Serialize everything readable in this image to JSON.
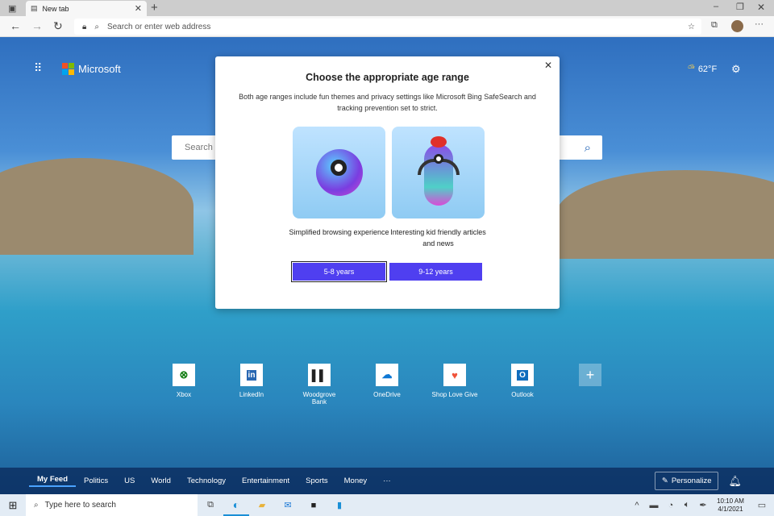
{
  "browser": {
    "tab_title": "New tab",
    "address_placeholder": "Search or enter web address"
  },
  "header": {
    "brand": "Microsoft",
    "weather": "62°F"
  },
  "search": {
    "placeholder": "Search the web"
  },
  "modal": {
    "title": "Choose the appropriate age range",
    "description": "Both age ranges include fun themes and privacy settings like Microsoft Bing SafeSearch and tracking prevention set to strict.",
    "options": [
      {
        "caption": "Simplified browsing experience",
        "button": "5-8 years"
      },
      {
        "caption": "Interesting kid friendly articles and news",
        "button": "9-12 years"
      }
    ]
  },
  "quick_links": [
    "Xbox",
    "LinkedIn",
    "Woodgrove Bank",
    "OneDrive",
    "Shop Love Give",
    "Outlook"
  ],
  "feed": {
    "tabs": [
      "My Feed",
      "Politics",
      "US",
      "World",
      "Technology",
      "Entertainment",
      "Sports",
      "Money"
    ],
    "more": "···",
    "personalize": "Personalize"
  },
  "taskbar": {
    "search_placeholder": "Type here to search",
    "time": "10:10 AM",
    "date": "4/1/2021"
  },
  "colors": {
    "accent": "#4f3ff0",
    "feed_bar": "#0a285a"
  }
}
